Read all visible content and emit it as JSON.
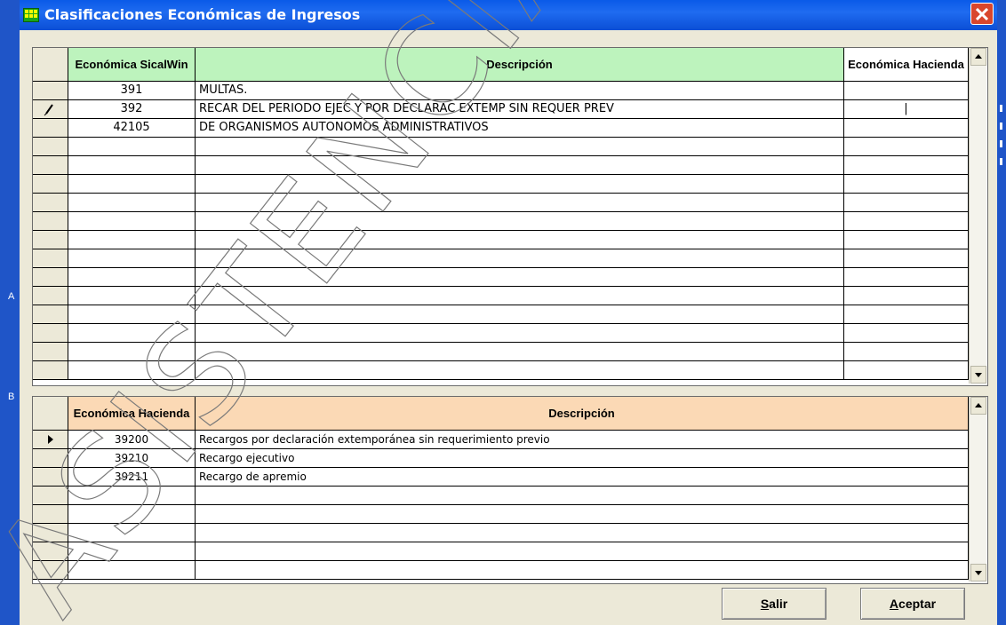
{
  "window": {
    "title": "Clasificaciones Económicas de Ingresos"
  },
  "side_labels": {
    "a": "A",
    "b": "B"
  },
  "top_grid": {
    "headers": [
      "Económica SicalWin",
      "Descripción",
      "Económica Hacienda"
    ],
    "header_color": "#bdf3bd",
    "rows": [
      {
        "code": "391",
        "desc": "MULTAS.",
        "hacienda": ""
      },
      {
        "code": "392",
        "desc": "RECAR DEL PERIODO EJEC Y POR DECLARAC EXTEMP SIN REQUER PREV",
        "hacienda": "|"
      },
      {
        "code": "42105",
        "desc": "DE ORGANISMOS AUTONOMOS ADMINISTRATIVOS",
        "hacienda": ""
      }
    ],
    "empty_rows": 13,
    "row_indicator_icon": "pencil-icon",
    "active_row": 1
  },
  "bottom_grid": {
    "headers": [
      "Económica Hacienda",
      "Descripción"
    ],
    "header_color": "#fbd9b5",
    "rows": [
      {
        "code": "39200",
        "desc": "Recargos por declaración extemporánea sin requerimiento previo"
      },
      {
        "code": "39210",
        "desc": "Recargo ejecutivo"
      },
      {
        "code": "39211",
        "desc": "Recargo de apremio"
      }
    ],
    "empty_rows": 5,
    "row_indicator_icon": "triangle-pointer-icon",
    "active_row": 0
  },
  "buttons": {
    "salir_mnemonic": "S",
    "salir_rest": "alir",
    "aceptar_mnemonic": "A",
    "aceptar_rest": "ceptar"
  },
  "watermark_text": "ASISTENCIA"
}
